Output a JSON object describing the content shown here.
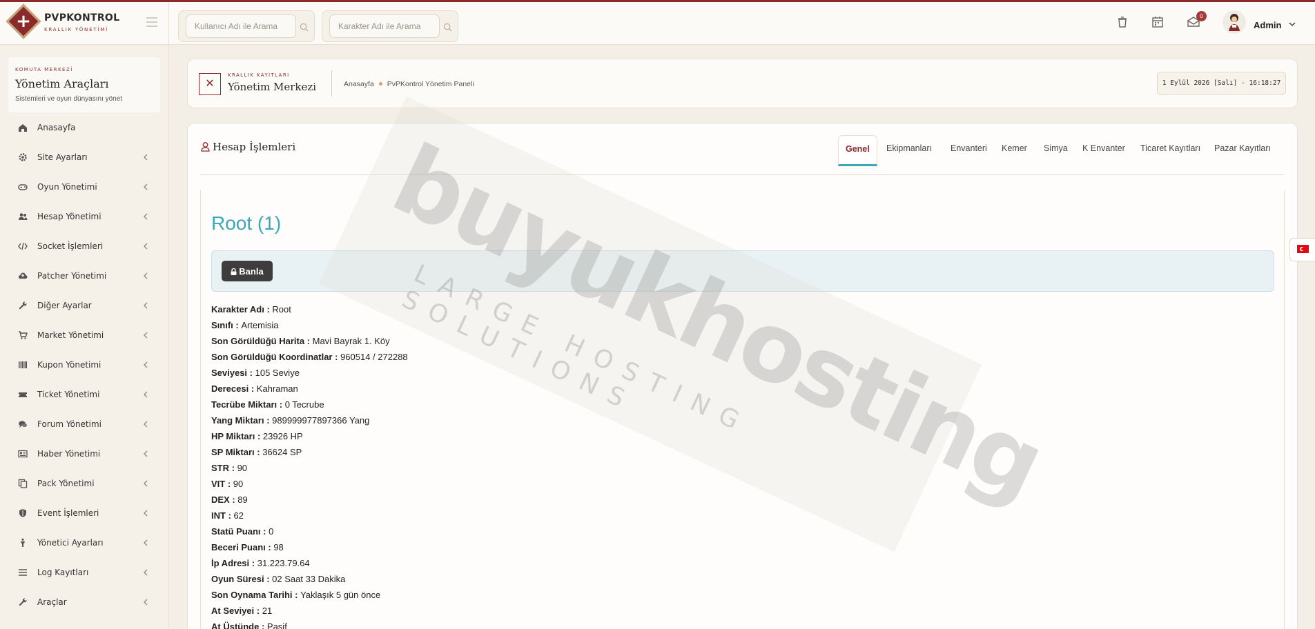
{
  "brand": {
    "title": "PVPKONTROL",
    "subtitle": "KRALLIK YÖNETİMİ"
  },
  "search": {
    "user_placeholder": "Kullanıcı Adı ile Arama",
    "char_placeholder": "Karakter Adı ile Arama"
  },
  "header": {
    "notification_count": "0",
    "admin_name": "Admin",
    "icons": [
      "trash-icon",
      "calendar-icon",
      "mail-icon",
      "avatar",
      "chevron-down-icon"
    ]
  },
  "sidebar": {
    "eyebrow": "KOMUTA MERKEZİ",
    "title": "Yönetim Araçları",
    "description": "Sistemleri ve oyun dünyasını yönet",
    "items": [
      {
        "label": "Anasayfa",
        "icon": "home-icon",
        "has_submenu": false
      },
      {
        "label": "Site Ayarları",
        "icon": "gear-icon",
        "has_submenu": true
      },
      {
        "label": "Oyun Yönetimi",
        "icon": "gamepad-icon",
        "has_submenu": true
      },
      {
        "label": "Hesap Yönetimi",
        "icon": "users-icon",
        "has_submenu": true
      },
      {
        "label": "Socket İşlemleri",
        "icon": "code-icon",
        "has_submenu": true
      },
      {
        "label": "Patcher Yönetimi",
        "icon": "cloud-upload-icon",
        "has_submenu": true
      },
      {
        "label": "Diğer Ayarlar",
        "icon": "wrench-icon",
        "has_submenu": true
      },
      {
        "label": "Market Yönetimi",
        "icon": "cart-icon",
        "has_submenu": true
      },
      {
        "label": "Kupon Yönetimi",
        "icon": "barcode-icon",
        "has_submenu": true
      },
      {
        "label": "Ticket Yönetimi",
        "icon": "ticket-icon",
        "has_submenu": true
      },
      {
        "label": "Forum Yönetimi",
        "icon": "comments-icon",
        "has_submenu": true
      },
      {
        "label": "Haber Yönetimi",
        "icon": "newspaper-icon",
        "has_submenu": true
      },
      {
        "label": "Pack Yönetimi",
        "icon": "copy-icon",
        "has_submenu": true
      },
      {
        "label": "Event İşlemleri",
        "icon": "shield-icon",
        "has_submenu": true
      },
      {
        "label": "Yönetici Ayarları",
        "icon": "person-icon",
        "has_submenu": true
      },
      {
        "label": "Log Kayıtları",
        "icon": "list-icon",
        "has_submenu": true
      },
      {
        "label": "Araçlar",
        "icon": "tools-icon",
        "has_submenu": true
      }
    ]
  },
  "breadcrumb": {
    "eyebrow": "KRALLIK KAYITLARI",
    "title": "Yönetim Merkezi",
    "home": "Anasayfa",
    "current": "PvPKontrol Yönetim Paneli",
    "datetime": "1 Eylül 2026 [Salı] - 16:18:27"
  },
  "card": {
    "title": "Hesap İşlemleri",
    "tabs": [
      {
        "label": "Genel",
        "active": true
      },
      {
        "label": "Ekipmanları",
        "active": false
      },
      {
        "label": "Envanteri",
        "active": false
      },
      {
        "label": "Kemer",
        "active": false
      },
      {
        "label": "Simya",
        "active": false
      },
      {
        "label": "K Envanter",
        "active": false
      },
      {
        "label": "Ticaret Kayıtları",
        "active": false
      },
      {
        "label": "Pazar Kayıtları",
        "active": false
      }
    ],
    "character_heading": "Root (1)",
    "ban_button": "Banla",
    "info": [
      {
        "label": "Karakter Adı",
        "value": "Root"
      },
      {
        "label": "Sınıfı",
        "value": "Artemisia"
      },
      {
        "label": "Son Görüldüğü Harita",
        "value": "Mavi Bayrak 1. Köy"
      },
      {
        "label": "Son Görüldüğü Koordinatlar",
        "value": "960514 / 272288"
      },
      {
        "label": "Seviyesi",
        "value": "105 Seviye"
      },
      {
        "label": "Derecesi",
        "value": "Kahraman"
      },
      {
        "label": "Tecrübe Miktarı",
        "value": "0 Tecrube"
      },
      {
        "label": "Yang Miktarı",
        "value": "989999977897366 Yang"
      },
      {
        "label": "HP Miktarı",
        "value": "23926 HP"
      },
      {
        "label": "SP Miktarı",
        "value": "36624 SP"
      },
      {
        "label": "STR",
        "value": "90"
      },
      {
        "label": "VIT",
        "value": "90"
      },
      {
        "label": "DEX",
        "value": "89"
      },
      {
        "label": "INT",
        "value": "62"
      },
      {
        "label": "Statü Puanı",
        "value": "0"
      },
      {
        "label": "Beceri Puanı",
        "value": "98"
      },
      {
        "label": "İp Adresi",
        "value": "31.223.79.64"
      },
      {
        "label": "Oyun Süresi",
        "value": "02 Saat 33 Dakika"
      },
      {
        "label": "Son Oynama Tarihi",
        "value": "Yaklaşık 5 gün önce"
      },
      {
        "label": "At Seviyei",
        "value": "21"
      },
      {
        "label": "At Üstünde",
        "value": "Pasif"
      }
    ]
  },
  "watermark": {
    "main": "buyukhosting",
    "sub": "LARGE HOSTING SOLUTIONS"
  },
  "colors": {
    "brand": "#8b2a2a",
    "accent": "#3aa8b8",
    "sidebar_bg": "#f5f0e8",
    "page_bg": "#f4efe6"
  }
}
